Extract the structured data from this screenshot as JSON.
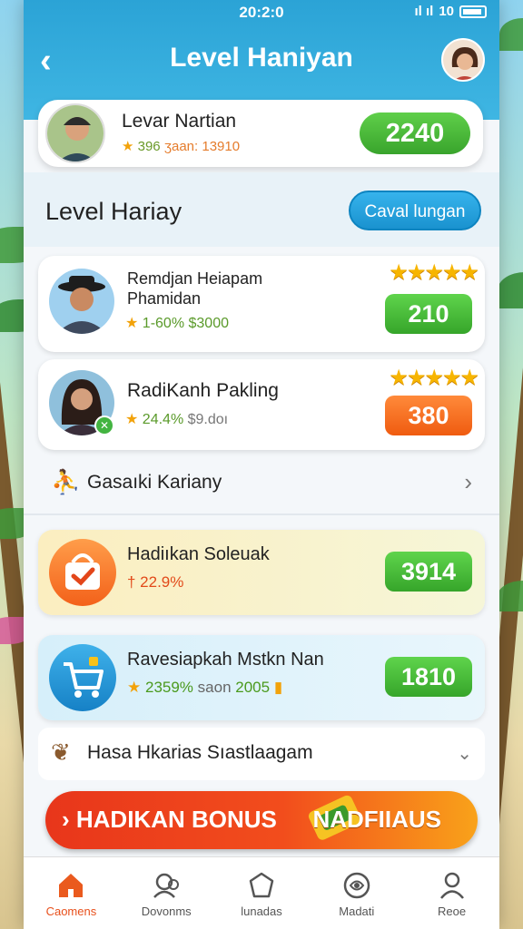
{
  "status_bar": {
    "time": "20:2:0",
    "signal": "ıl ıl",
    "network": "10"
  },
  "header": {
    "title": "Level Haniyan"
  },
  "profile": {
    "name": "Levar Nartian",
    "stat_score": "396",
    "stat_label": "ʒaan: 13910",
    "badge_value": "2240"
  },
  "section": {
    "title": "Level Hariay",
    "button_label": "Caval lungan"
  },
  "entries": [
    {
      "name_line1": "Remdjan Heiapam",
      "name_line2": "Phamidan",
      "percent": "1-60%",
      "amount": "$3000",
      "value": "210",
      "stars": "★★★★★"
    },
    {
      "name": "RadiKanh Pakling",
      "percent": "24.4%",
      "amount": "$9.doı",
      "value": "380",
      "stars": "★★★★★"
    }
  ],
  "row_link": {
    "label": "Gasaıki Kariany"
  },
  "promos": [
    {
      "title": "Hadiıkan Soleuak",
      "stat": "† 22.9%",
      "value": "3914"
    },
    {
      "title": "Ravesiapkah Mstkn Nan",
      "percent": "2359%",
      "label": "saon",
      "amount": "2005",
      "value": "1810"
    }
  ],
  "collapse_row": {
    "label": "Hasa Hkarias Sıastlaagam"
  },
  "bonus": {
    "left_label": "› HADIKAN BONUS",
    "right_label": "NADFIIAUS"
  },
  "tabs": [
    {
      "label": "Caomens",
      "icon": "home-icon",
      "active": true
    },
    {
      "label": "Dovonms",
      "icon": "users-icon",
      "active": false
    },
    {
      "label": "lunadas",
      "icon": "shield-icon",
      "active": false
    },
    {
      "label": "Madati",
      "icon": "badge-icon",
      "active": false
    },
    {
      "label": "Reoe",
      "icon": "profile-icon",
      "active": false
    }
  ],
  "colors": {
    "header": "#2ba3d6",
    "accent_green": "#39a42c",
    "accent_orange": "#ef5b10",
    "active_tab": "#e8501c"
  }
}
